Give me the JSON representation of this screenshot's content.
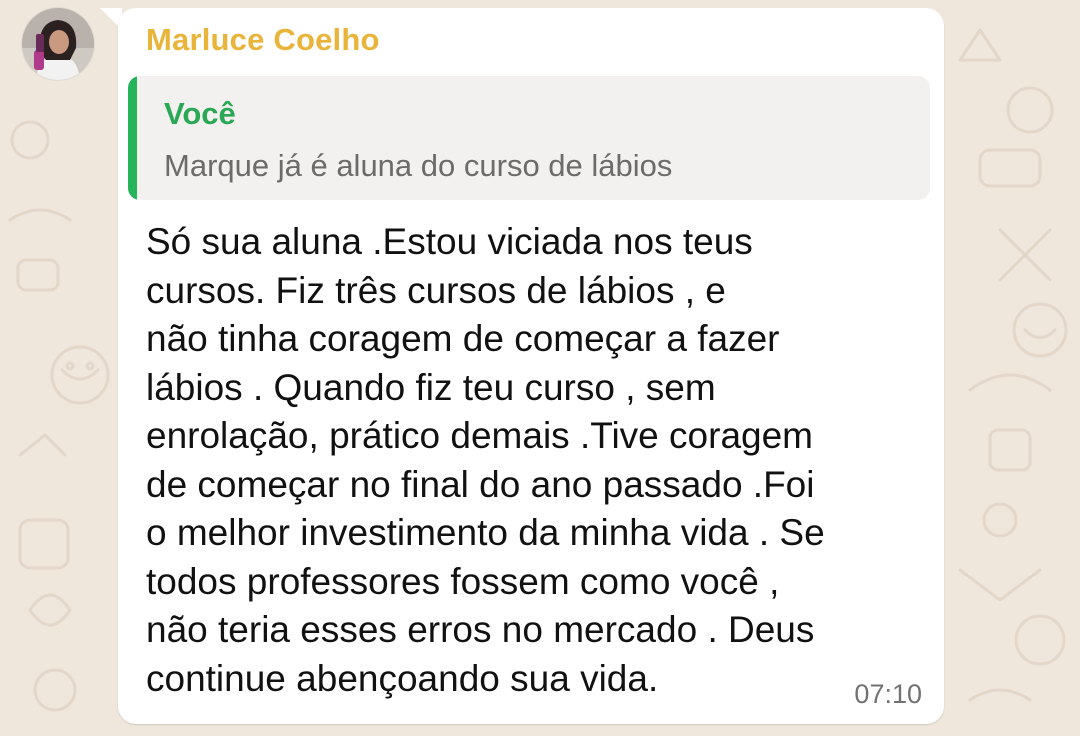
{
  "chat": {
    "sender_name": "Marluce Coelho",
    "avatar_icon": "profile-photo",
    "quoted": {
      "author": "Você",
      "text": "Marque já é aluna do curso de lábios"
    },
    "message_text": "Só sua aluna .Estou viciada nos teus\ncursos.  Fiz três cursos de lábios , e\nnão tinha coragem de começar a fazer\nlábios . Quando fiz teu curso , sem\nenrolação, prático demais .Tive coragem\nde começar no final do ano passado .Foi\no melhor investimento da minha vida . Se\ntodos professores fossem como você ,\nnão teria esses erros no mercado . Deus\ncontinue abençoando sua vida.",
    "time": "07:10"
  },
  "colors": {
    "sender_name": "#e9b43a",
    "quote_accent": "#25b35c",
    "quote_author": "#2aa855",
    "wallpaper": "#efe7dc",
    "bubble": "#ffffff"
  }
}
